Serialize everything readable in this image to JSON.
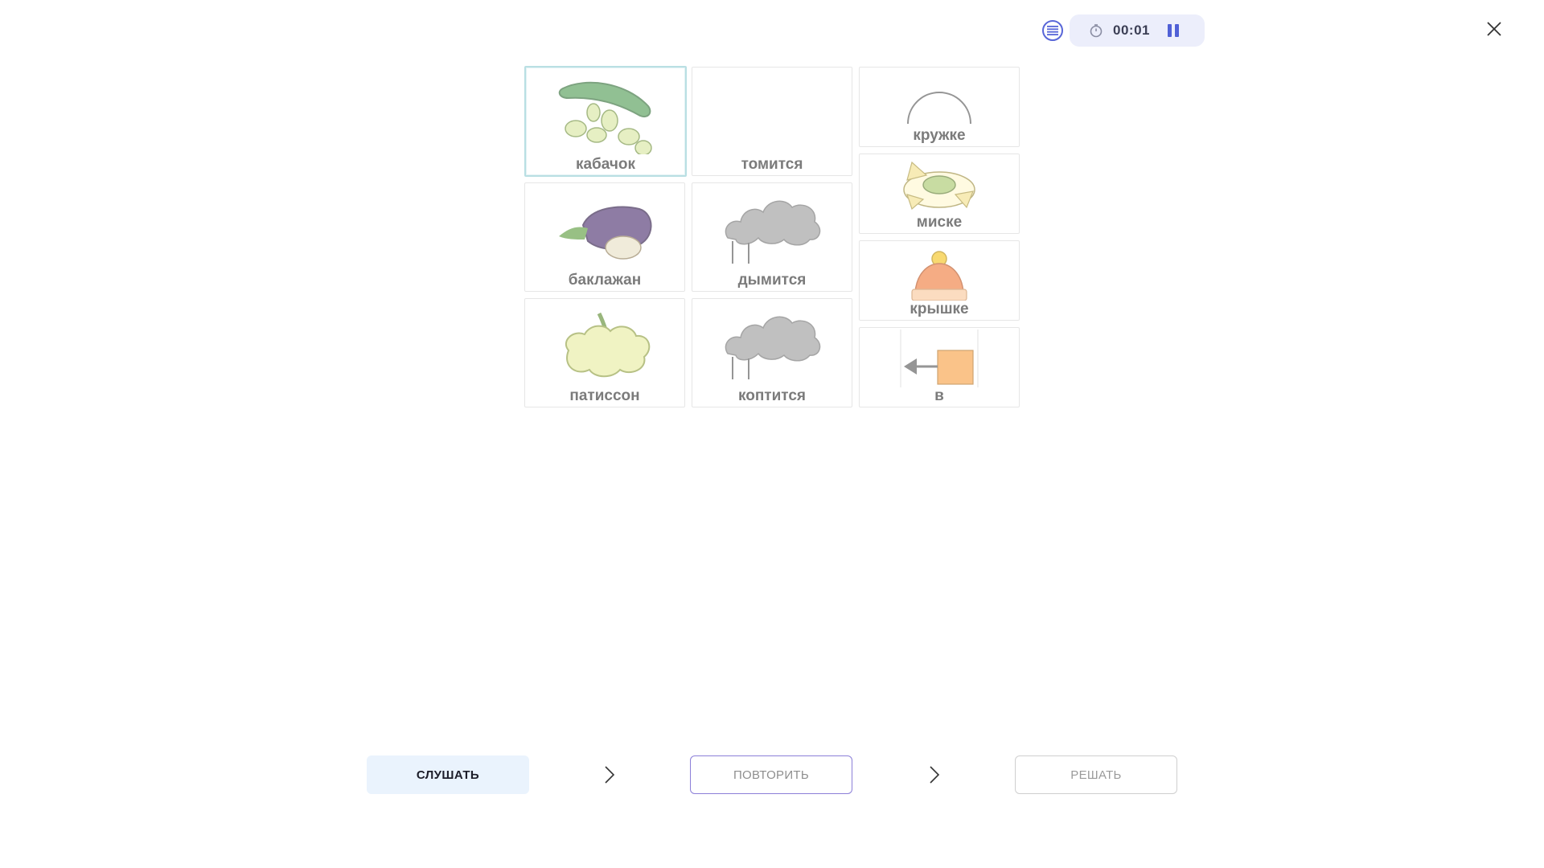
{
  "header": {
    "timer": "00:01"
  },
  "tiles": [
    {
      "label": "кабачок",
      "icon": "zucchini-icon"
    },
    {
      "label": "томится",
      "icon": "blank"
    },
    {
      "label": "кружке",
      "icon": "mug-icon"
    },
    {
      "label": "баклажан",
      "icon": "eggplant-icon"
    },
    {
      "label": "дымится",
      "icon": "smoke-icon"
    },
    {
      "label": "миске",
      "icon": "bowl-icon"
    },
    {
      "label": "патиссон",
      "icon": "pattypan-squash-icon"
    },
    {
      "label": "коптится",
      "icon": "smoke-icon"
    },
    {
      "label": "крышке",
      "icon": "hat-lid-icon"
    },
    {
      "label": "в",
      "icon": "into-arrow-icon"
    }
  ],
  "bottom": {
    "listen_label": "СЛУШАТЬ",
    "repeat_label": "ПОВТОРИТЬ",
    "solve_label": "РЕШАТЬ"
  },
  "colors": {
    "accent": "#5866d8",
    "timer_bg": "#eceefb",
    "listen_bg": "#eaf3fd",
    "repeat_border": "#8c7fd8",
    "selected_border": "#b9dfe3"
  }
}
